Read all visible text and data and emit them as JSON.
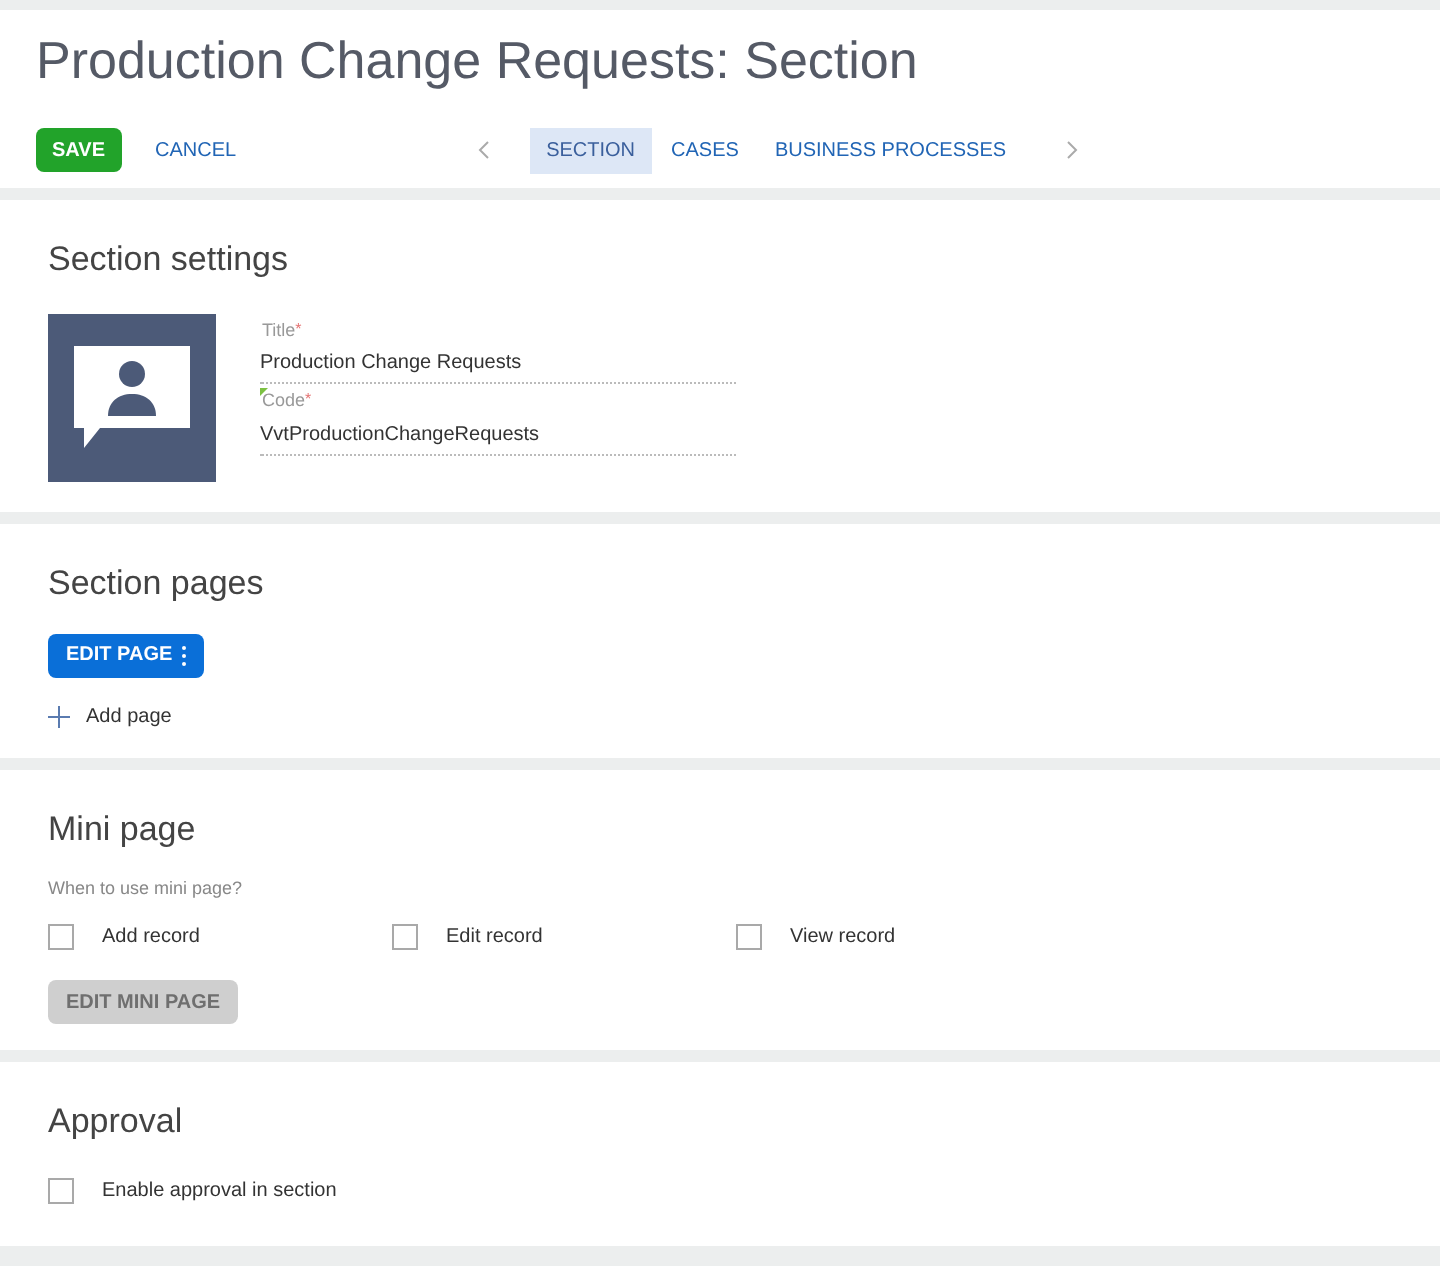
{
  "header": {
    "title": "Production Change Requests: Section",
    "actions": [
      {
        "label": "SAVE",
        "kind": "primary"
      },
      {
        "label": "CANCEL",
        "kind": "link"
      }
    ],
    "tabs": [
      {
        "label": "SECTION",
        "selected": true
      },
      {
        "label": "CASES",
        "selected": false
      },
      {
        "label": "BUSINESS PROCESSES",
        "selected": false
      }
    ]
  },
  "section_settings": {
    "heading": "Section settings",
    "fields": [
      {
        "label": "Title",
        "required_mark": "*",
        "value": "Production Change Requests",
        "marked": false
      },
      {
        "label": "Code",
        "required_mark": "*",
        "value": "VvtProductionChangeRequests",
        "marked": true
      }
    ]
  },
  "section_pages": {
    "heading": "Section pages",
    "edit_button": {
      "label": "EDIT PAGE"
    },
    "add_link": {
      "label": "Add page"
    }
  },
  "mini_page": {
    "heading": "Mini page",
    "prompt": "When to use mini page?",
    "options": [
      {
        "label": "Add record",
        "checked": false
      },
      {
        "label": "Edit record",
        "checked": false
      },
      {
        "label": "View record",
        "checked": false
      }
    ],
    "edit_button": {
      "label": "EDIT MINI PAGE",
      "disabled": true
    }
  },
  "approval": {
    "heading": "Approval",
    "options": [
      {
        "label": "Enable approval in section",
        "checked": false
      }
    ]
  }
}
